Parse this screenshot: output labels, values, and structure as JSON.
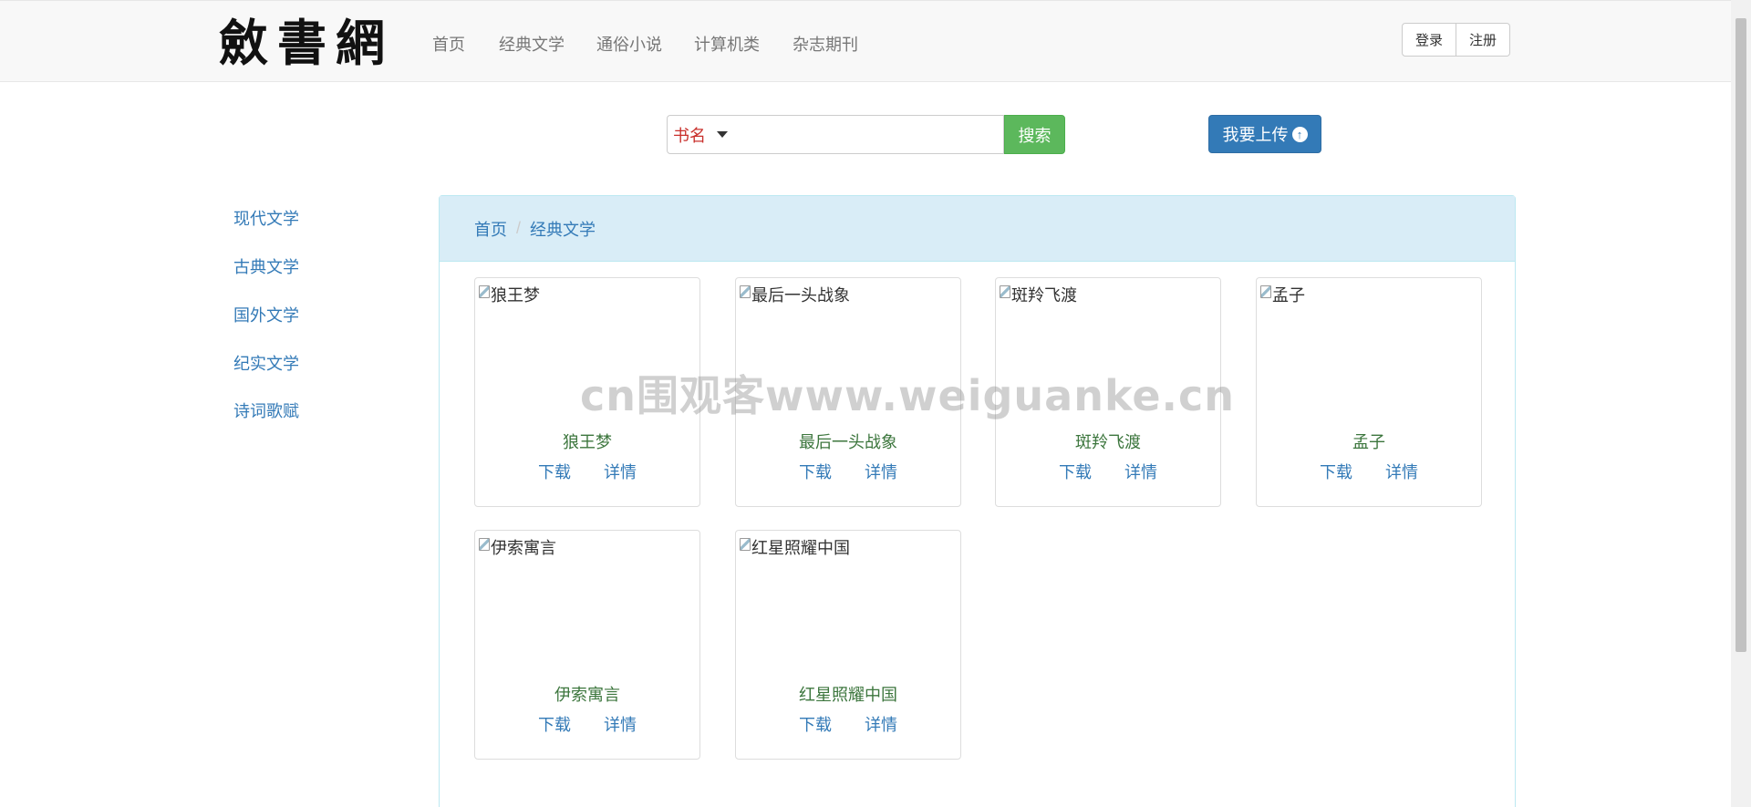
{
  "header": {
    "logo_text": "斂書網",
    "nav": [
      "首页",
      "经典文学",
      "通俗小说",
      "计算机类",
      "杂志期刊"
    ],
    "login_label": "登录",
    "register_label": "注册"
  },
  "search": {
    "type_label": "书名",
    "placeholder": "",
    "button_label": "搜索"
  },
  "upload": {
    "label": "我要上传",
    "icon": "arrow-up-circle-icon"
  },
  "sidebar": {
    "items": [
      "现代文学",
      "古典文学",
      "国外文学",
      "纪实文学",
      "诗词歌赋"
    ]
  },
  "breadcrumb": {
    "home": "首页",
    "current": "经典文学"
  },
  "books": [
    {
      "title": "狼王梦",
      "alt": "狼王梦"
    },
    {
      "title": "最后一头战象",
      "alt": "最后一头战象"
    },
    {
      "title": "斑羚飞渡",
      "alt": "斑羚飞渡"
    },
    {
      "title": "孟子",
      "alt": "孟子"
    },
    {
      "title": "伊索寓言",
      "alt": "伊索寓言"
    },
    {
      "title": "红星照耀中国",
      "alt": "红星照耀中国"
    }
  ],
  "book_actions": {
    "download": "下载",
    "details": "详情"
  },
  "watermark": "cn围观客www.weiguanke.cn",
  "colors": {
    "primary": "#337ab7",
    "success": "#5cb85c",
    "danger_text": "#c9302c",
    "panel_heading": "#d9edf7",
    "book_title": "#3c763d"
  }
}
